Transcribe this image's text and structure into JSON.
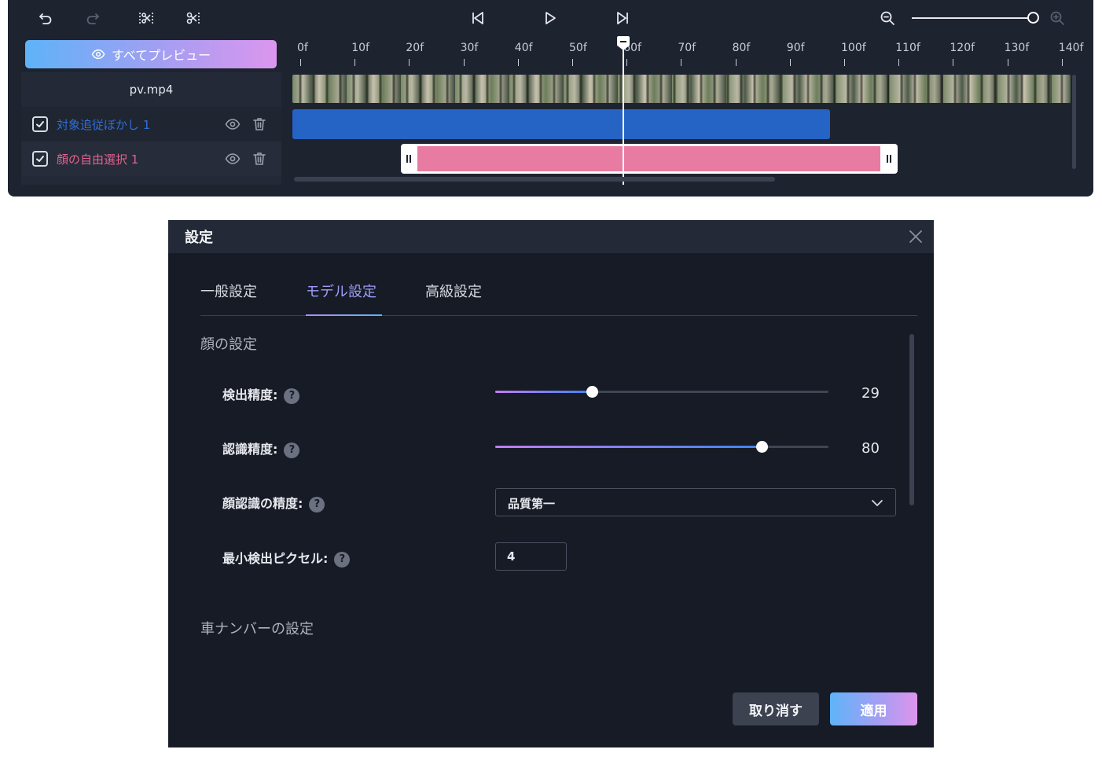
{
  "timeline": {
    "toolbar": {
      "undo_icon": "undo-icon",
      "redo_icon": "redo-icon",
      "split_icon": "split-icon",
      "cut_icon": "scissors-icon",
      "prev_icon": "skip-back-icon",
      "play_icon": "play-icon",
      "next_icon": "skip-forward-icon",
      "zoom_out_icon": "zoom-out-icon",
      "zoom_in_icon": "zoom-in-icon",
      "zoom_level": 1.0
    },
    "preview_button": "すべてプレビュー",
    "file_name": "pv.mp4",
    "tracks": [
      {
        "label": "対象追従ぼかし 1",
        "checked": true,
        "color": "#2f6ed8"
      },
      {
        "label": "顔の自由選択 1",
        "checked": true,
        "color": "#e2628f"
      }
    ],
    "ruler": [
      "0f",
      "10f",
      "20f",
      "30f",
      "40f",
      "50f",
      "60f",
      "70f",
      "80f",
      "90f",
      "100f",
      "110f",
      "120f",
      "130f",
      "140f"
    ],
    "playhead_frame": "60f"
  },
  "dialog": {
    "title": "設定",
    "tabs": [
      {
        "label": "一般設定",
        "active": false
      },
      {
        "label": "モデル設定",
        "active": true
      },
      {
        "label": "高級設定",
        "active": false
      }
    ],
    "face_section": {
      "title": "顔の設定",
      "detection_precision": {
        "label": "検出精度:",
        "value": 29,
        "max": 100
      },
      "recognition_precision": {
        "label": "認識精度:",
        "value": 80,
        "max": 100
      },
      "face_recognition_accuracy": {
        "label": "顔認識の精度:",
        "selected": "品質第一"
      },
      "min_detect_pixels": {
        "label": "最小検出ピクセル:",
        "value": "4"
      }
    },
    "plate_section": {
      "title": "車ナンバーの設定"
    },
    "buttons": {
      "cancel": "取り消す",
      "apply": "適用"
    },
    "help_glyph": "?"
  },
  "colors": {
    "accent_purple": "#9f9cf7",
    "accent_blue": "#5cb6f7",
    "panel_bg": "#161b25"
  }
}
